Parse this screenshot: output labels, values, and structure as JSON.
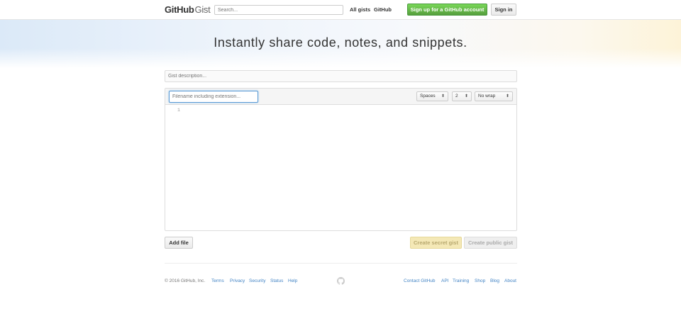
{
  "header": {
    "logo_bold": "GitHub",
    "logo_light": "Gist",
    "search_placeholder": "Search...",
    "nav_all_gists": "All gists",
    "nav_github": "GitHub",
    "signup_label": "Sign up for a GitHub account",
    "signin_label": "Sign in"
  },
  "hero": {
    "title": "Instantly share code, notes, and snippets."
  },
  "form": {
    "description_placeholder": "Gist description...",
    "filename_placeholder": "Filename including extension...",
    "indent_mode": "Spaces",
    "indent_size": "2",
    "wrap_mode": "No wrap",
    "line_number": "1",
    "add_file_label": "Add file",
    "create_secret_label": "Create secret gist",
    "create_public_label": "Create public gist"
  },
  "footer": {
    "copyright": "© 2016 GitHub, Inc.",
    "left_links": [
      "Terms",
      "Privacy",
      "Security",
      "Status",
      "Help"
    ],
    "right_links": [
      "Contact GitHub",
      "API",
      "Training",
      "Shop",
      "Blog",
      "About"
    ]
  },
  "colors": {
    "signup_green": "#6cc644",
    "link_blue": "#4183c4",
    "secret_yellow": "#f4e8b6"
  }
}
